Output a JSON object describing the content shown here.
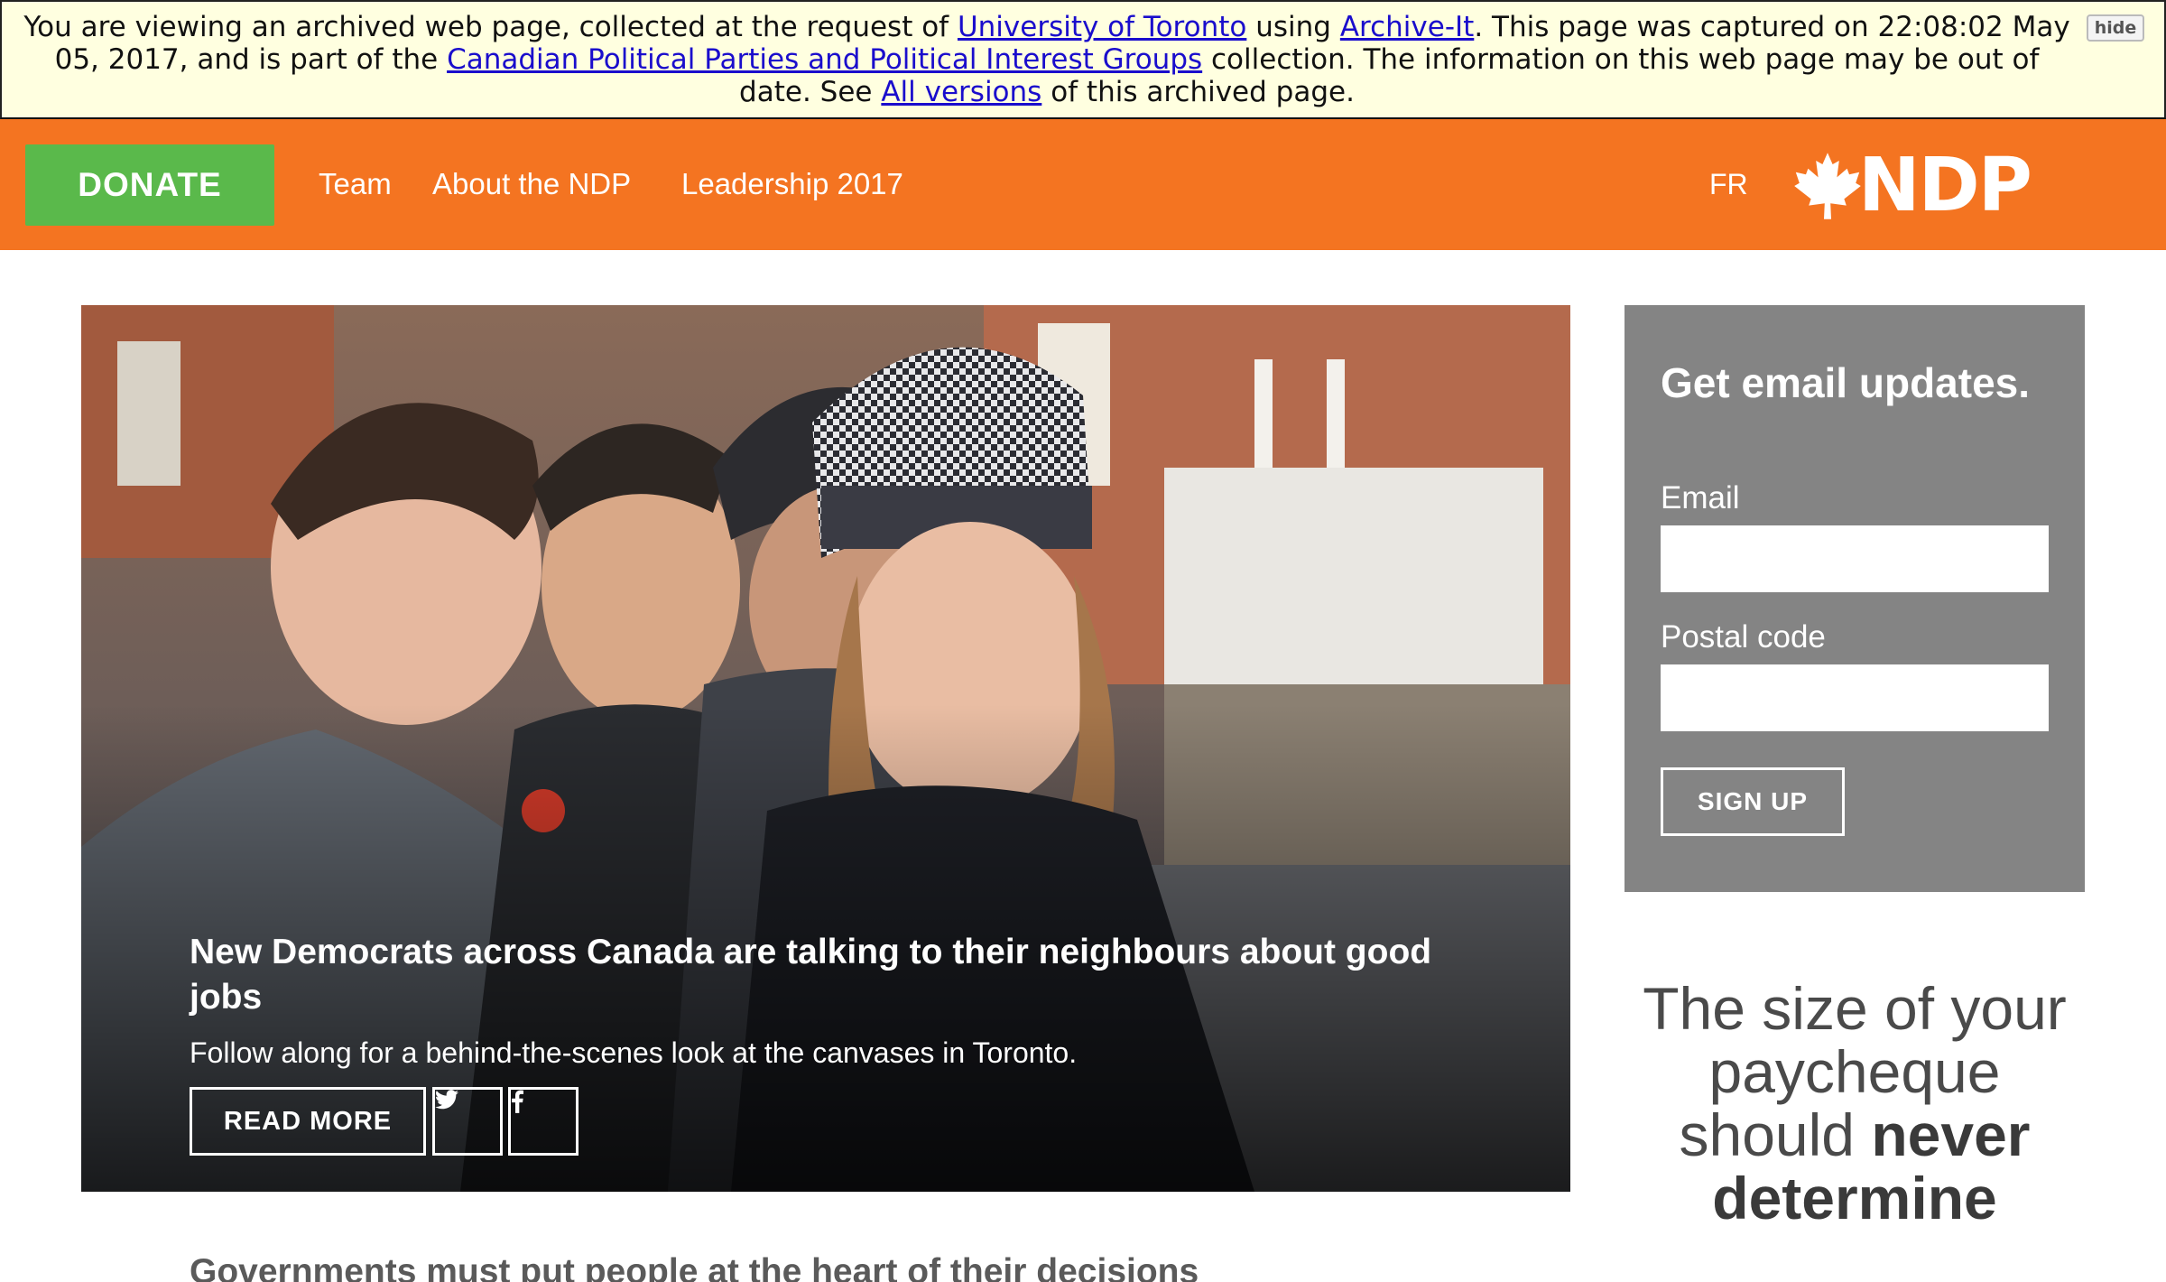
{
  "archive_banner": {
    "text_1": "You are viewing an archived web page, collected at the request of",
    "link_org": "University of Toronto",
    "text_2": "using",
    "link_service": "Archive-It",
    "text_3": ". This page was captured on 22:08:02 May 05, 2017, and is part of the",
    "link_collection": "Canadian Political Parties and Political Interest Groups",
    "text_4": "collection. The information on this web page may be out of date. See",
    "link_versions": "All versions",
    "text_5": "of this archived page.",
    "hide_label": "hide"
  },
  "nav": {
    "donate_label": "DONATE",
    "links": [
      "Team",
      "About the NDP",
      "Leadership 2017"
    ],
    "lang_label": "FR",
    "logo_text": "NDP",
    "colors": {
      "bar": "#f47421",
      "donate": "#5ab94b"
    }
  },
  "hero": {
    "title": "New Democrats across Canada are talking to their neighbours about good jobs",
    "subtitle": "Follow along for a behind-the-scenes look at the canvases in Toronto.",
    "read_more_label": "READ MORE",
    "share_icons": [
      "twitter-icon",
      "facebook-icon"
    ]
  },
  "signup": {
    "title": "Get email updates.",
    "email_label": "Email",
    "email_value": "",
    "postal_label": "Postal code",
    "postal_value": "",
    "button_label": "SIGN UP"
  },
  "quote": {
    "part_1": "The size of your paycheque should",
    "emphasis": "never determine"
  },
  "article": {
    "heading": "Governments must put people at the heart of their decisions"
  }
}
